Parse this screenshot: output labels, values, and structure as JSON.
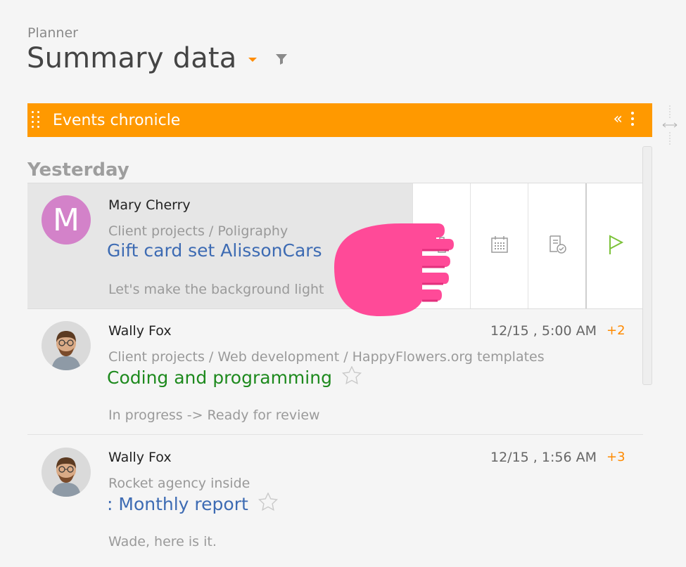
{
  "header": {
    "app_name": "Planner",
    "title": "Summary data"
  },
  "widget": {
    "title": "Events chronicle",
    "collapse_glyph": "«"
  },
  "feed": {
    "section_label": "Yesterday",
    "items": [
      {
        "author": "Mary Cherry",
        "avatar_letter": "M",
        "path": "Client projects / Poligraphy",
        "subject": "Gift card set AlissonCars",
        "subject_color": "#3d6bb3",
        "snippet": "Let's make the background light",
        "time": "",
        "count": ""
      },
      {
        "author": "Wally Fox",
        "path": "Client projects / Web development / HappyFlowers.org templates",
        "subject": "Coding and programming",
        "subject_color": "#1e8a1e",
        "snippet": "In progress -> Ready for review",
        "time": "12/15 , 5:00 AM",
        "count": "+2"
      },
      {
        "author": "Wally Fox",
        "path": "Rocket agency inside",
        "subject": ": Monthly report",
        "subject_color": "#3d6bb3",
        "snippet": "Wade, here is it.",
        "time": "12/15 , 1:56 AM",
        "count": "+3"
      }
    ]
  },
  "row_actions": [
    "delete-icon",
    "calendar-icon",
    "approve-document-icon",
    "flag-icon"
  ],
  "colors": {
    "accent": "#ff9900",
    "pointer": "#ff4a98",
    "avatar_m": "#d382c9"
  }
}
